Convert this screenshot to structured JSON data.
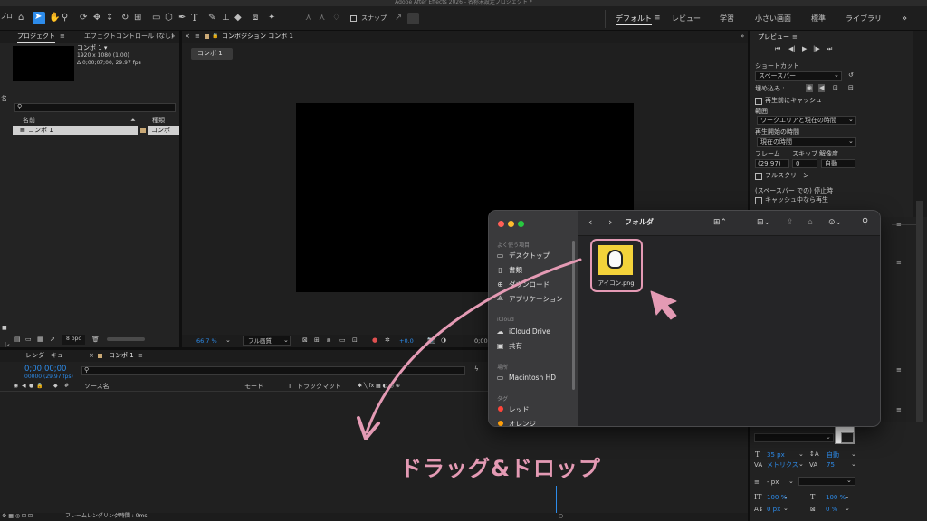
{
  "window_title": "Adobe After Effects 2026 - 名称未設定プロジェクト *",
  "toolbar": {
    "snap_label": "スナップ",
    "workspaces": [
      "デフォルト",
      "レビュー",
      "学習",
      "小さい画面",
      "標準",
      "ライブラリ"
    ],
    "more": "»"
  },
  "project_panel": {
    "tab_project": "プロジェクト",
    "tab_effects": "エフェクトコントロール (なし)",
    "comp_name": "コンポ 1 ▾",
    "comp_res": "1920 x 1080 (1.00)",
    "comp_dur": "Δ 0;00;07;00, 29.97 fps",
    "col_name": "名前",
    "col_type": "種類",
    "row_name": "コンポ 1",
    "row_type": "コンポ",
    "bpc": "8 bpc"
  },
  "comp_panel": {
    "tab": "コンポジション コンポ 1",
    "subtab": "コンポ 1",
    "zoom": "66.7 %",
    "quality": "フル画質",
    "exposure": "+0.0",
    "timecode": "0;00"
  },
  "timeline": {
    "tab_render": "レンダーキュー",
    "tab_comp": "コンポ 1",
    "timecode": "0;00;00;00",
    "frame_info": "00000 (29.97 fps)",
    "col_source": "ソース名",
    "col_mode": "モード",
    "col_t": "T",
    "col_track": "トラックマット",
    "footer": "フレームレンダリング時間 : 0ms"
  },
  "preview_panel": {
    "title": "プレビュー",
    "shortcut_label": "ショートカット",
    "shortcut_value": "スペースバー",
    "include_label": "埋め込み :",
    "cache_before": "再生前にキャッシュ",
    "range_label": "範囲",
    "range_value": "ワークエリアと現在の時間",
    "start_label": "再生開始の時間",
    "start_value": "現在の時間",
    "frame_label": "フレーム",
    "skip_label": "スキップ",
    "res_label": "解像度",
    "frame_value": "(29.97)",
    "skip_value": "0",
    "res_value": "自動",
    "fullscreen": "フルスクリーン",
    "stop_label": "(スペースバー での) 停止時 :",
    "cache_playing": "キャッシュ中なら再生"
  },
  "char_panel": {
    "font_size": "35 px",
    "leading": "自動",
    "tracking_label": "メトリクス",
    "tracking_value": "75",
    "stroke": "- px",
    "vscale": "100 %",
    "hscale": "100 %",
    "baseline": "0 px",
    "tsume": "0 %"
  },
  "finder": {
    "title": "フォルダ",
    "sections": {
      "favorites": "よく使う項目",
      "icloud": "iCloud",
      "locations": "場所",
      "tags": "タグ"
    },
    "favorites": [
      "デスクトップ",
      "書類",
      "ダウンロード",
      "アプリケーション"
    ],
    "icloud_items": [
      "iCloud Drive",
      "共有"
    ],
    "locations": [
      "Macintosh HD"
    ],
    "tags": [
      "レッド",
      "オレンジ"
    ],
    "file_name": "アイコン.png"
  },
  "annotation": {
    "text": "ドラッグ&ドロップ",
    "color": "#e49ab4"
  },
  "colors": {
    "accent_blue": "#2d8ceb",
    "tag_red": "#ff453a",
    "tag_orange": "#ff9f0a",
    "file_bg": "#f3d23a"
  }
}
